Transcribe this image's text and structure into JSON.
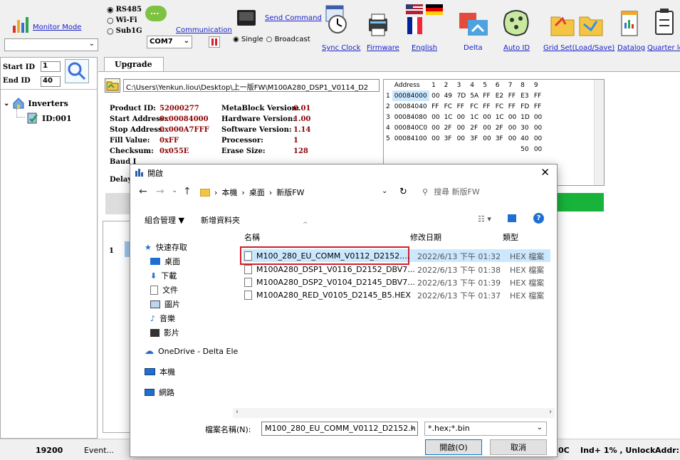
{
  "toolbar": {
    "monitor_mode": "Monitor Mode",
    "radio_rs485": "RS485",
    "radio_wifi": "Wi-Fi",
    "radio_sub1g": "Sub1G",
    "com_port": "COM7",
    "communication": "Communication",
    "send_command": "Send Command",
    "radio_single": "Single",
    "radio_broadcast": "Broadcast",
    "sync_clock": "Sync Clock",
    "firmware": "Firmware",
    "english": "English",
    "delta": "Delta",
    "auto_id": "Auto ID",
    "grid_set": "Grid Set(Load/Save)",
    "datalog": "Datalog",
    "quarter": "Quarter lo"
  },
  "left": {
    "start_id_label": "Start ID",
    "start_id_value": "1",
    "end_id_label": "End ID",
    "end_id_value": "40",
    "tree_root": "Inverters",
    "tree_child": "ID:001"
  },
  "main": {
    "tab_upgrade": "Upgrade",
    "file_path": "C:\\Users\\Yenkun.liou\\Desktop\\上一版FW\\M100A280_DSP1_V0114_D2",
    "product_id_label": "Product ID:",
    "product_id": "52000277",
    "start_addr_label": "Start Address:",
    "start_addr": "0x00084000",
    "stop_addr_label": "Stop Address:",
    "stop_addr": "0x000A7FFF",
    "fill_label": "Fill Value:",
    "fill": "0xFF",
    "checksum_label": "Checksum:",
    "checksum": "0x055E",
    "baud_label": "Baud I",
    "delay_label": "Delay:",
    "mb_ver_label": "MetaBlock Version:",
    "mb_ver": "0.01",
    "hw_ver_label": "Hardware Version:",
    "hw_ver": "1.00",
    "sw_ver_label": "Software Version:",
    "sw_ver": "1.14",
    "proc_label": "Processor:",
    "proc": "1",
    "erase_label": "Erase Size:",
    "erase": "128",
    "grid_row1": "1",
    "hex_header": [
      "Address",
      "1",
      "2",
      "3",
      "4",
      "5",
      "6",
      "7",
      "8",
      "9"
    ],
    "hex_rows": [
      [
        "1",
        "00084000",
        "00",
        "49",
        "7D",
        "5A",
        "FF",
        "E2",
        "FF",
        "E3",
        "FF"
      ],
      [
        "2",
        "00084040",
        "FF",
        "FC",
        "FF",
        "FC",
        "FF",
        "FC",
        "FF",
        "FD",
        "FF"
      ],
      [
        "3",
        "00084080",
        "00",
        "1C",
        "00",
        "1C",
        "00",
        "1C",
        "00",
        "1D",
        "00"
      ],
      [
        "4",
        "000840C0",
        "00",
        "2F",
        "00",
        "2F",
        "00",
        "2F",
        "00",
        "30",
        "00"
      ],
      [
        "5",
        "00084100",
        "00",
        "3F",
        "00",
        "3F",
        "00",
        "3F",
        "00",
        "40",
        "00"
      ]
    ],
    "hex_extra": [
      "50",
      "00"
    ]
  },
  "dialog": {
    "title": "開啟",
    "breadcrumb": [
      "本機",
      "桌面",
      "新版FW"
    ],
    "search_placeholder": "搜尋 新版FW",
    "organize": "組合管理 ▼",
    "new_folder": "新增資料夾",
    "col_name": "名稱",
    "col_date": "修改日期",
    "col_type": "類型",
    "nav": [
      "快速存取",
      "桌面",
      "下載",
      "文件",
      "圖片",
      "音樂",
      "影片",
      "OneDrive - Delta Ele",
      "本機",
      "網路"
    ],
    "files": [
      {
        "name": "M100_280_EU_COMM_V0112_D2152....",
        "date": "2022/6/13 下午 01:32",
        "type": "HEX 檔案"
      },
      {
        "name": "M100A280_DSP1_V0116_D2152_DBV7...",
        "date": "2022/6/13 下午 01:38",
        "type": "HEX 檔案"
      },
      {
        "name": "M100A280_DSP2_V0104_D2145_DBV7...",
        "date": "2022/6/13 下午 01:39",
        "type": "HEX 檔案"
      },
      {
        "name": "M100A280_RED_V0105_D2145_B5.HEX",
        "date": "2022/6/13 下午 01:37",
        "type": "HEX 檔案"
      }
    ],
    "filename_label": "檔案名稱(N):",
    "filename_value": "M100_280_EU_COMM_V0112_D2152.h",
    "filter": "*.hex;*.bin",
    "open_btn": "開啟(O)",
    "cancel_btn": "取消"
  },
  "status": {
    "baud": "19200",
    "event": "Event...",
    "partial": "0C",
    "ind": "Ind+ 1% , Unlock",
    "addr": "Addr:"
  },
  "colors": {
    "accent_red": "#d11f2b",
    "green_bar": "#17b33b",
    "selection": "#cce8ff",
    "link": "#1a23c8"
  }
}
